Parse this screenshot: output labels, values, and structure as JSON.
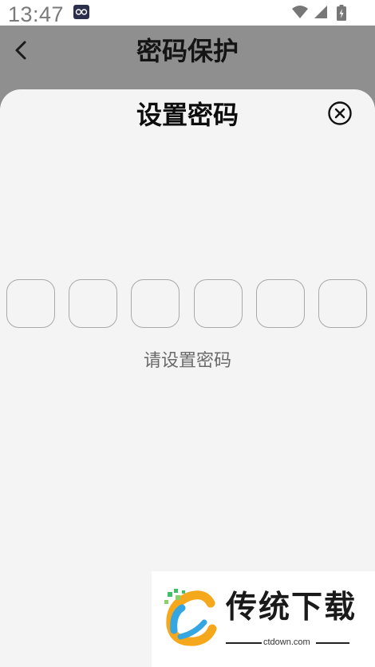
{
  "status_bar": {
    "time": "13:47",
    "icons": [
      "app-notification-icon",
      "wifi-icon",
      "signal-icon",
      "battery-charging-icon"
    ]
  },
  "header": {
    "title": "密码保护",
    "back_icon": "chevron-left-icon"
  },
  "sheet": {
    "title": "设置密码",
    "close_icon": "close-circle-icon",
    "pin_length": 6,
    "hint": "请设置密码"
  },
  "watermark": {
    "name": "传统下载",
    "domain": "ctdown.com"
  },
  "colors": {
    "dim_overlay": "#8f8f8f",
    "sheet_background": "#f4f4f4",
    "pin_border": "#a9a9a9",
    "hint_text": "#6a6a6a"
  }
}
